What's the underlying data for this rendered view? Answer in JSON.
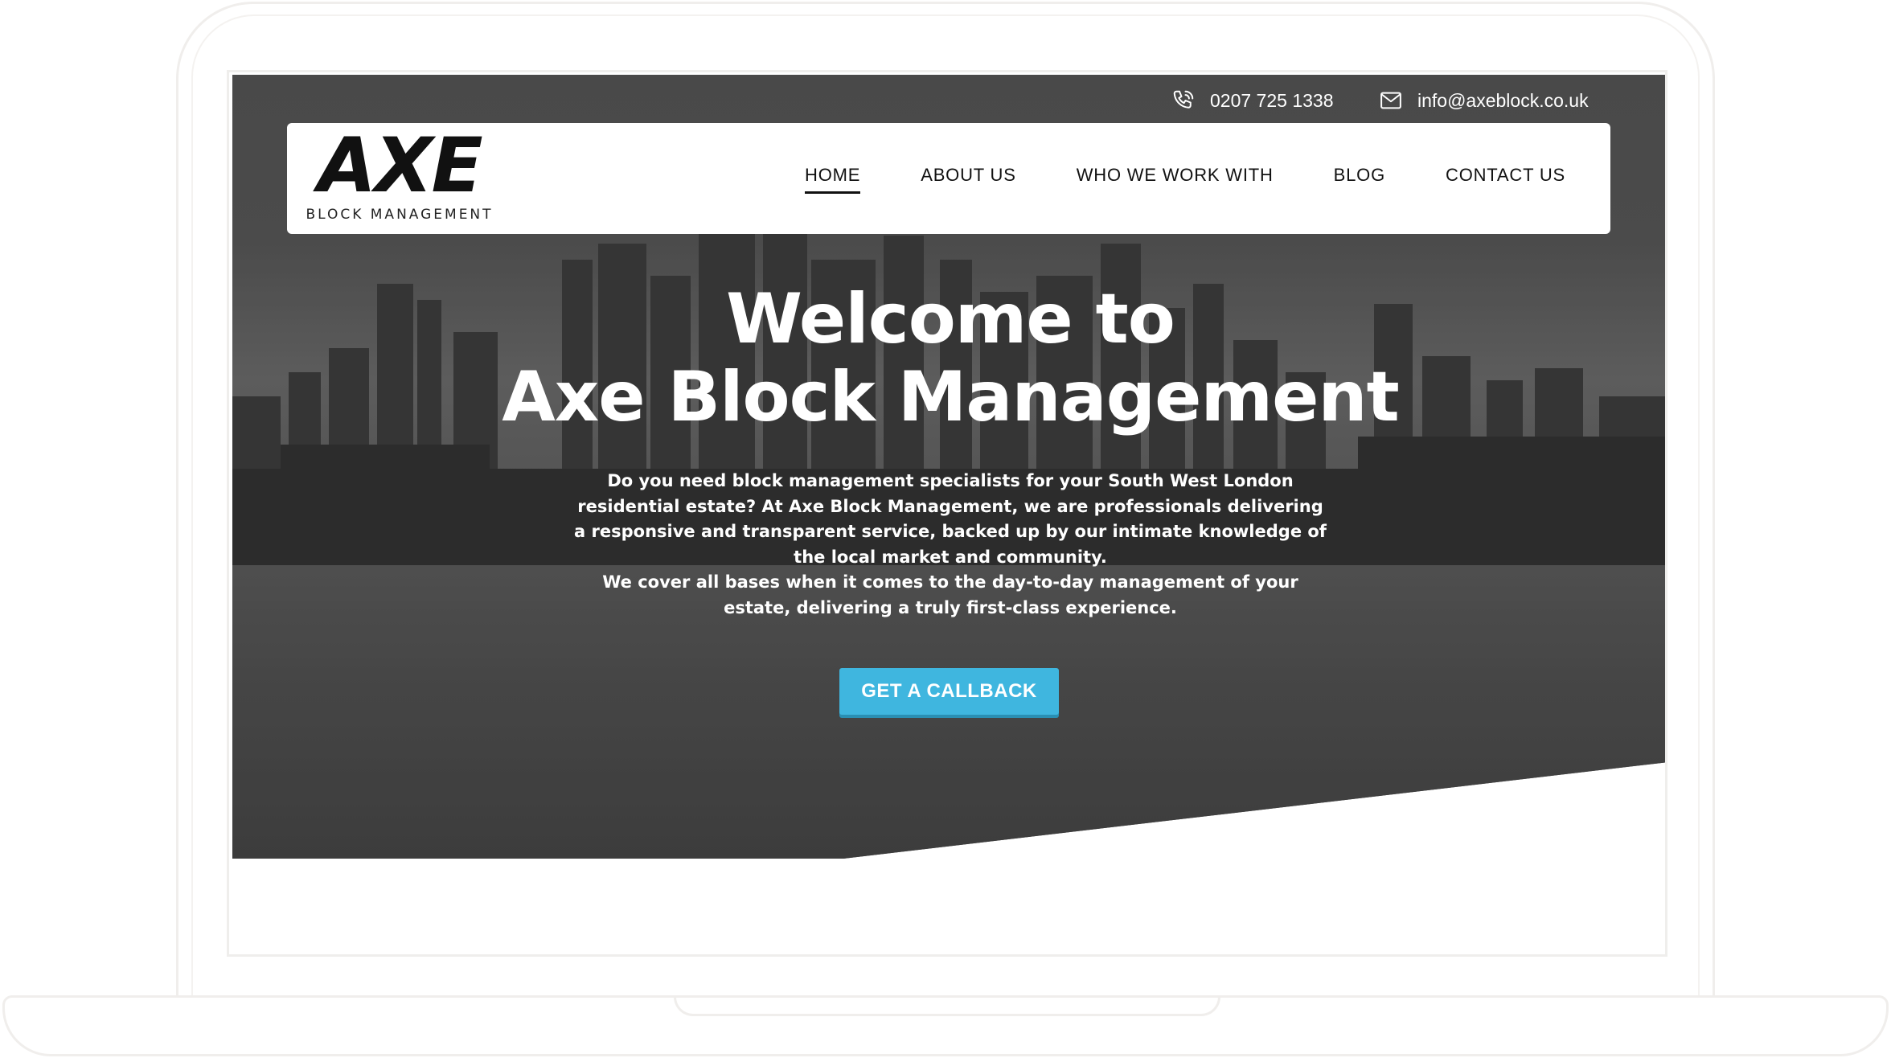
{
  "topbar": {
    "phone": "0207 725 1338",
    "email": "info@axeblock.co.uk",
    "phone_icon": "phone-icon",
    "email_icon": "mail-icon"
  },
  "logo": {
    "title": "AXE",
    "subtitle": "BLOCK MANAGEMENT"
  },
  "nav": {
    "items": [
      "HOME",
      "ABOUT US",
      "WHO WE WORK WITH",
      "BLOG",
      "CONTACT US"
    ],
    "active": "HOME"
  },
  "hero": {
    "title_line1": "Welcome to",
    "title_line2": "Axe Block Management",
    "paragraph1": "Do you need block management specialists for your South West London residential estate? At Axe Block Management, we are professionals delivering a responsive and transparent service, backed up by our intimate knowledge of the local market and community.",
    "paragraph2": "We cover all bases when it comes to the day-to-day management of your estate, delivering a truly first-class experience.",
    "cta_label": "GET A CALLBACK"
  },
  "colors": {
    "accent": "#3fb6df",
    "hero_overlay": "#555555",
    "text_light": "#ffffff",
    "nav_text": "#111111"
  }
}
